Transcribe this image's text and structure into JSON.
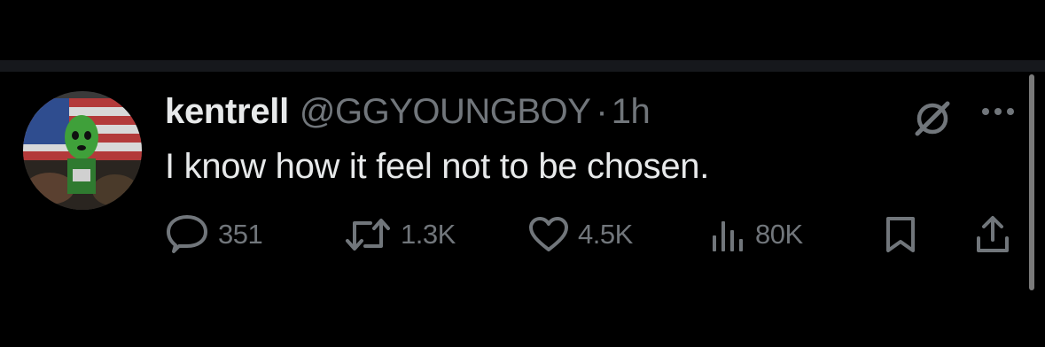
{
  "post": {
    "display_name": "kentrell",
    "handle": "@GGYOUNGBOY",
    "separator": "·",
    "time": "1h",
    "text": "I know how it feel not to be chosen."
  },
  "metrics": {
    "replies": "351",
    "reposts": "1.3K",
    "likes": "4.5K",
    "views": "80K"
  },
  "icons": {
    "grok": "grok-icon",
    "more": "more-horizontal-icon",
    "reply": "reply-icon",
    "repost": "repost-icon",
    "like": "heart-icon",
    "views": "views-bar-chart-icon",
    "bookmark": "bookmark-icon",
    "share": "share-icon"
  },
  "colors": {
    "background": "#000000",
    "primary_text": "#e7e9ea",
    "secondary_text": "#71767b",
    "divider": "#16181c"
  }
}
